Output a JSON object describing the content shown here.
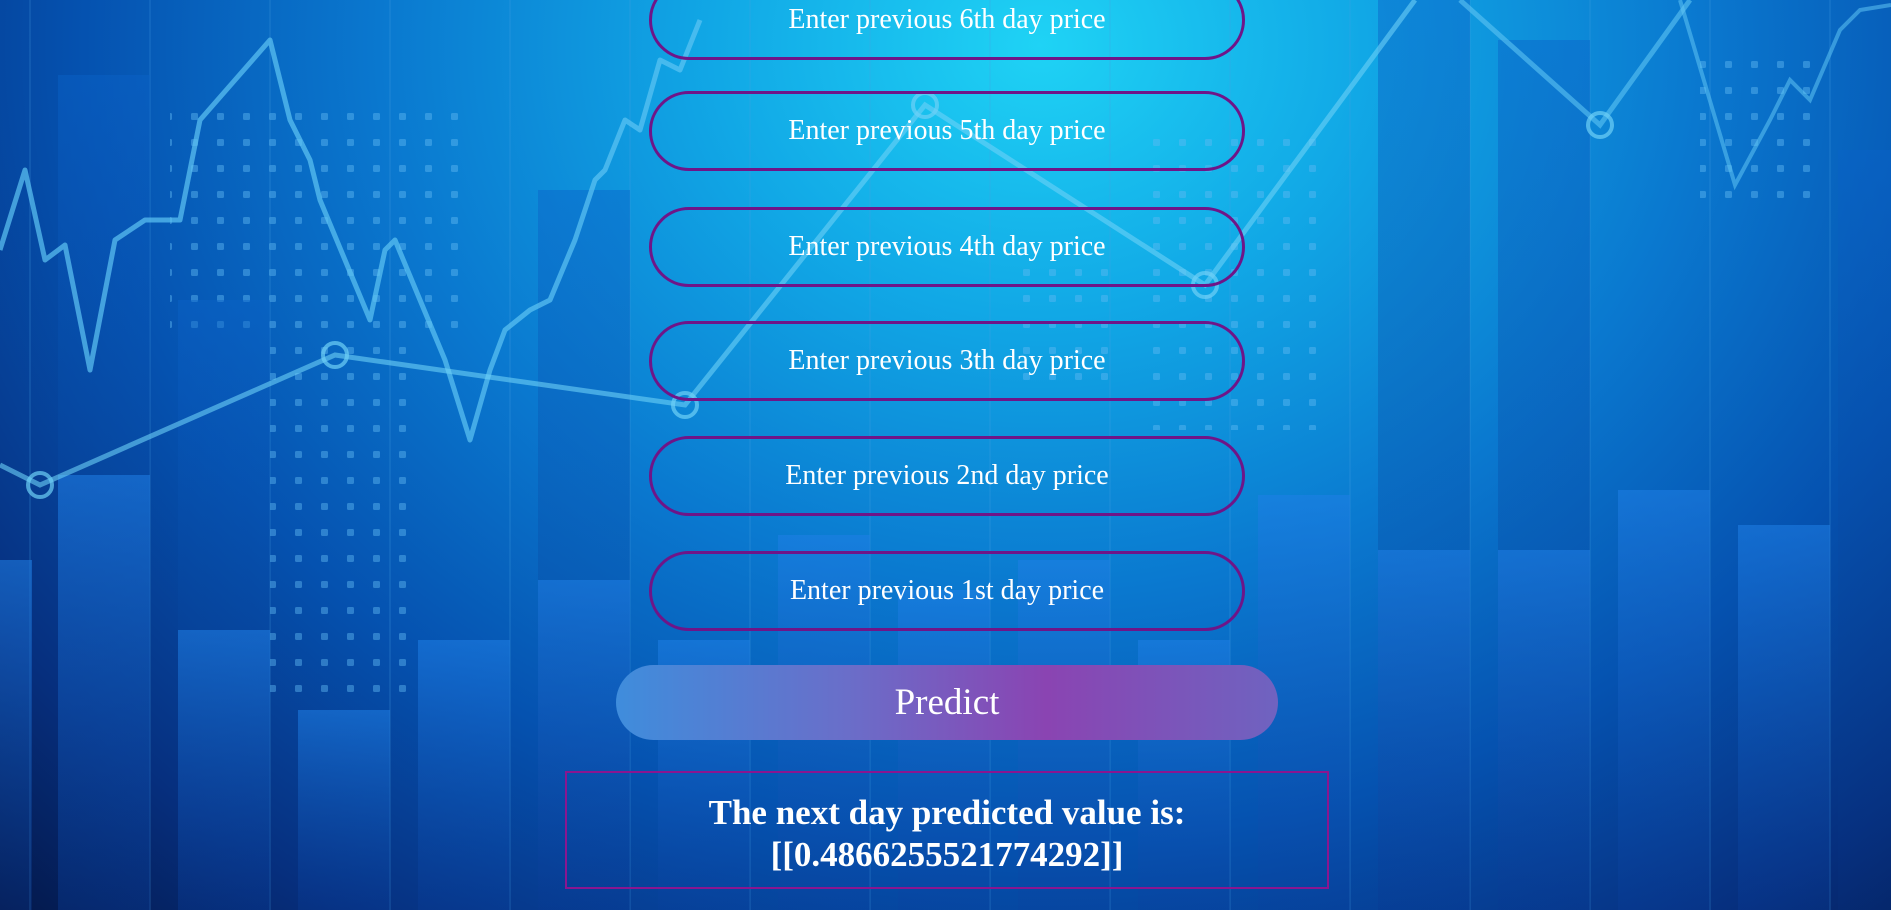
{
  "inputs": [
    {
      "placeholder": "Enter previous 6th day price"
    },
    {
      "placeholder": "Enter previous 5th day price"
    },
    {
      "placeholder": "Enter previous 4th day price"
    },
    {
      "placeholder": "Enter previous 3th day price"
    },
    {
      "placeholder": "Enter previous 2nd day price"
    },
    {
      "placeholder": "Enter previous 1st day price"
    }
  ],
  "predict_button": {
    "label": "Predict"
  },
  "result": {
    "line1": "The next day predicted value is:",
    "line2": "[[0.4866255521774292]]"
  },
  "colors": {
    "input_border": "#6f1588",
    "result_border": "#8a1690",
    "text": "#ffffff"
  }
}
